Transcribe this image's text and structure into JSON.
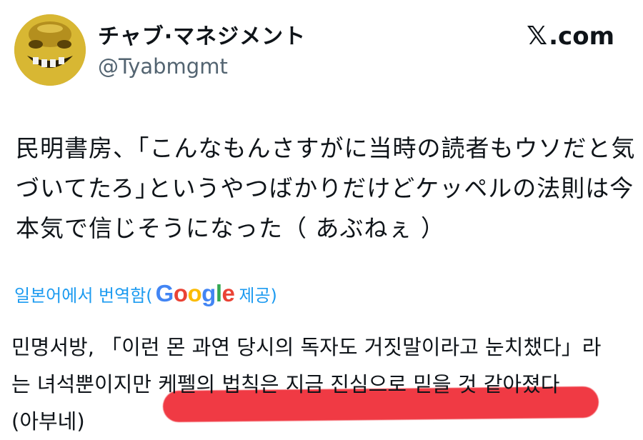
{
  "author": {
    "display_name": "チャブ·マネジメント",
    "handle": "@Tyabmgmt",
    "avatar_icon": "gold-grinning-mask-avatar"
  },
  "site": {
    "logo_icon": "x-logo-icon",
    "label": ".com"
  },
  "tweet": {
    "lines": [
      "民明書房、｢こんなもんさすがに当時の読者もウソだと気",
      "づいてたろ｣というやつばかりだけどケッペルの法則は今",
      "本気で信じそうになった（ あぶねぇ ）"
    ]
  },
  "translation": {
    "label_prefix": "일본어에서 번역함(",
    "provider": "Google",
    "label_suffix": " 제공)",
    "lines": [
      "민명서방, 「이런 몬 과연 당시의 독자도 거짓말이라고 눈치챘다」라",
      "는 녀석뿐이지만 케펠의 법칙은 지금 진심으로 믿을 것 같아졌다",
      "(아부네)"
    ]
  },
  "colors": {
    "text": "#0f1419",
    "secondary": "#536471",
    "link": "#1d9bf0",
    "highlight": "#f0303a"
  }
}
